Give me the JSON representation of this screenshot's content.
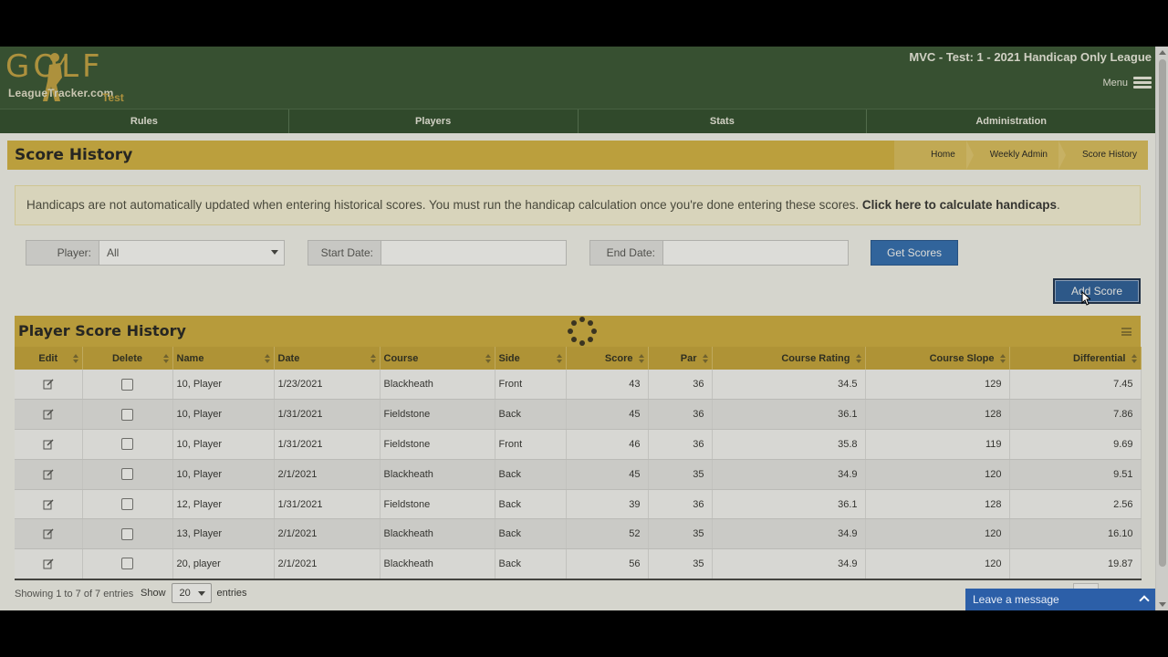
{
  "header": {
    "logo_word": "GOLF",
    "logo_sub": "LeagueTracker.com",
    "logo_badge": "Test",
    "league_title": "MVC - Test: 1 - 2021 Handicap Only League",
    "menu_label": "Menu"
  },
  "nav": [
    "Rules",
    "Players",
    "Stats",
    "Administration"
  ],
  "page": {
    "title": "Score History",
    "breadcrumb": [
      "Home",
      "Weekly Admin",
      "Score History"
    ]
  },
  "alert": {
    "text": "Handicaps are not automatically updated when entering historical scores. You must run the handicap calculation once you're done entering these scores. ",
    "link": "Click here to calculate handicaps",
    "suffix": "."
  },
  "filters": {
    "player_label": "Player:",
    "player_value": "All",
    "start_label": "Start Date:",
    "start_value": "",
    "end_label": "End Date:",
    "end_value": "",
    "get_button": "Get Scores",
    "add_button": "Add Score"
  },
  "panel": {
    "title": "Player Score History"
  },
  "table": {
    "columns": [
      "Edit",
      "Delete",
      "Name",
      "Date",
      "Course",
      "Side",
      "Score",
      "Par",
      "Course Rating",
      "Course Slope",
      "Differential"
    ],
    "rows": [
      [
        "10, Player",
        "1/23/2021",
        "Blackheath",
        "Front",
        "43",
        "36",
        "34.5",
        "129",
        "7.45"
      ],
      [
        "10, Player",
        "1/31/2021",
        "Fieldstone",
        "Back",
        "45",
        "36",
        "36.1",
        "128",
        "7.86"
      ],
      [
        "10, Player",
        "1/31/2021",
        "Fieldstone",
        "Front",
        "46",
        "36",
        "35.8",
        "119",
        "9.69"
      ],
      [
        "10, Player",
        "2/1/2021",
        "Blackheath",
        "Back",
        "45",
        "35",
        "34.9",
        "120",
        "9.51"
      ],
      [
        "12, Player",
        "1/31/2021",
        "Fieldstone",
        "Back",
        "39",
        "36",
        "36.1",
        "128",
        "2.56"
      ],
      [
        "13, Player",
        "2/1/2021",
        "Blackheath",
        "Back",
        "52",
        "35",
        "34.9",
        "120",
        "16.10"
      ],
      [
        "20, player",
        "2/1/2021",
        "Blackheath",
        "Back",
        "56",
        "35",
        "34.9",
        "120",
        "19.87"
      ]
    ]
  },
  "footer": {
    "info": "Showing 1 to 7 of 7 entries",
    "show_label": "Show",
    "show_value": "20",
    "entries_label": "entries"
  },
  "chat": {
    "label": "Leave a message"
  },
  "colors": {
    "header_green": "#365534",
    "gold": "#d2b040",
    "button_blue": "#2f6db5"
  }
}
